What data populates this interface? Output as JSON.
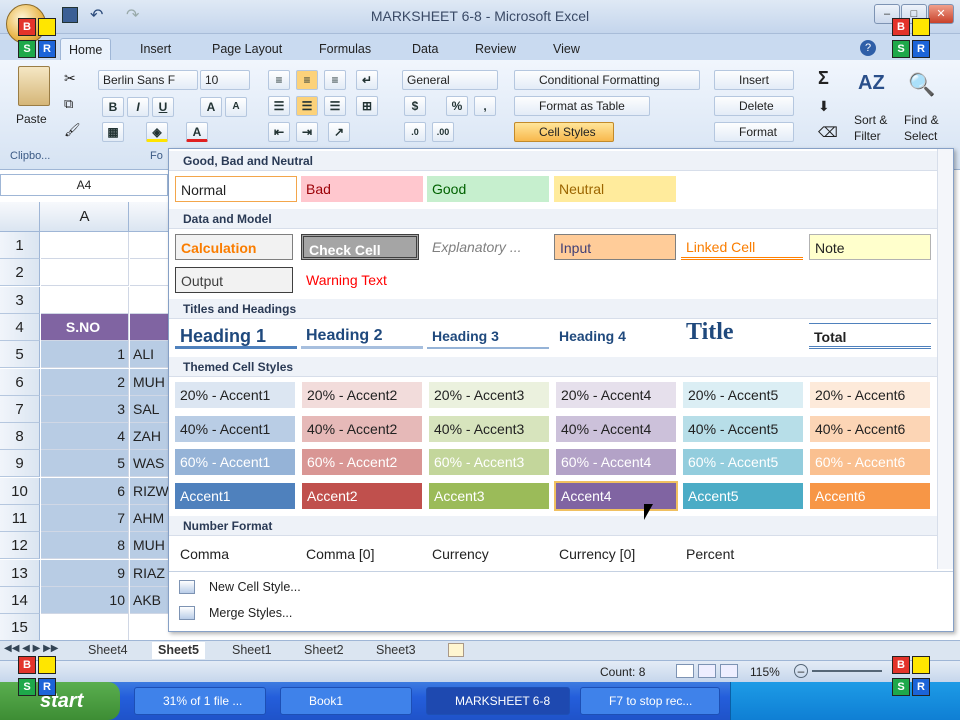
{
  "window": {
    "title": "MARKSHEET 6-8 - Microsoft Excel"
  },
  "tabs": [
    "Home",
    "Insert",
    "Page Layout",
    "Formulas",
    "Data",
    "Review",
    "View"
  ],
  "ribbon": {
    "paste": "Paste",
    "clipboard": "Clipbo...",
    "font_group": "Fo",
    "font_name": "Berlin Sans F",
    "font_size": "10",
    "number_format": "General",
    "conditional_formatting": "Conditional Formatting",
    "format_as_table": "Format as Table",
    "cell_styles": "Cell Styles",
    "insert": "Insert",
    "delete": "Delete",
    "format": "Format",
    "sort_filter": "Sort &",
    "sort_filter2": "Filter",
    "find_select": "Find &",
    "find_select2": "Select",
    "sigma": "Σ"
  },
  "namebox": "A4",
  "column_a": "A",
  "rows": [
    {
      "n": "1",
      "a": "",
      "b": ""
    },
    {
      "n": "2",
      "a": "",
      "b": ""
    },
    {
      "n": "3",
      "a": "",
      "b": ""
    },
    {
      "n": "4",
      "a": "S.NO",
      "b": ""
    },
    {
      "n": "5",
      "a": "1",
      "b": "ALI"
    },
    {
      "n": "6",
      "a": "2",
      "b": "MUH"
    },
    {
      "n": "7",
      "a": "3",
      "b": "SAL"
    },
    {
      "n": "8",
      "a": "4",
      "b": "ZAH"
    },
    {
      "n": "9",
      "a": "5",
      "b": "WAS"
    },
    {
      "n": "10",
      "a": "6",
      "b": "RIZW"
    },
    {
      "n": "11",
      "a": "7",
      "b": "AHM"
    },
    {
      "n": "12",
      "a": "8",
      "b": "MUH"
    },
    {
      "n": "13",
      "a": "9",
      "b": "RIAZ"
    },
    {
      "n": "14",
      "a": "10",
      "b": "AKB"
    },
    {
      "n": "15",
      "a": "",
      "b": ""
    }
  ],
  "gallery": {
    "sections": {
      "good": "Good, Bad and Neutral",
      "data": "Data and Model",
      "titles": "Titles and Headings",
      "themed": "Themed Cell Styles",
      "number": "Number Format"
    },
    "good_styles": [
      "Normal",
      "Bad",
      "Good",
      "Neutral"
    ],
    "data_styles": [
      "Calculation",
      "Check Cell",
      "Explanatory ...",
      "Input",
      "Linked Cell",
      "Note",
      "Output",
      "Warning Text"
    ],
    "title_styles": [
      "Heading 1",
      "Heading 2",
      "Heading 3",
      "Heading 4",
      "Title",
      "Total"
    ],
    "themed_20": [
      "20% - Accent1",
      "20% - Accent2",
      "20% - Accent3",
      "20% - Accent4",
      "20% - Accent5",
      "20% - Accent6"
    ],
    "themed_40": [
      "40% - Accent1",
      "40% - Accent2",
      "40% - Accent3",
      "40% - Accent4",
      "40% - Accent5",
      "40% - Accent6"
    ],
    "themed_60": [
      "60% - Accent1",
      "60% - Accent2",
      "60% - Accent3",
      "60% - Accent4",
      "60% - Accent5",
      "60% - Accent6"
    ],
    "themed_100": [
      "Accent1",
      "Accent2",
      "Accent3",
      "Accent4",
      "Accent5",
      "Accent6"
    ],
    "number_styles": [
      "Comma",
      "Comma [0]",
      "Currency",
      "Currency [0]",
      "Percent"
    ],
    "new_cell_style": "New Cell Style...",
    "merge_styles": "Merge Styles..."
  },
  "accent_colors": {
    "a1": "#4f81bd",
    "a2": "#c0504d",
    "a3": "#9bbb59",
    "a4": "#8064a2",
    "a5": "#4bacc6",
    "a6": "#f79646"
  },
  "sheet_tabs": [
    "Sheet4",
    "Sheet5",
    "Sheet1",
    "Sheet2",
    "Sheet3"
  ],
  "status": {
    "count": "Count: 8",
    "zoom": "115%"
  },
  "taskbar": {
    "start": "start",
    "items": [
      "31% of 1 file ...",
      "Book1",
      "MARKSHEET 6-8",
      "F7 to stop rec..."
    ]
  },
  "overlay": {
    "letters": [
      "B",
      "S",
      "R"
    ]
  }
}
